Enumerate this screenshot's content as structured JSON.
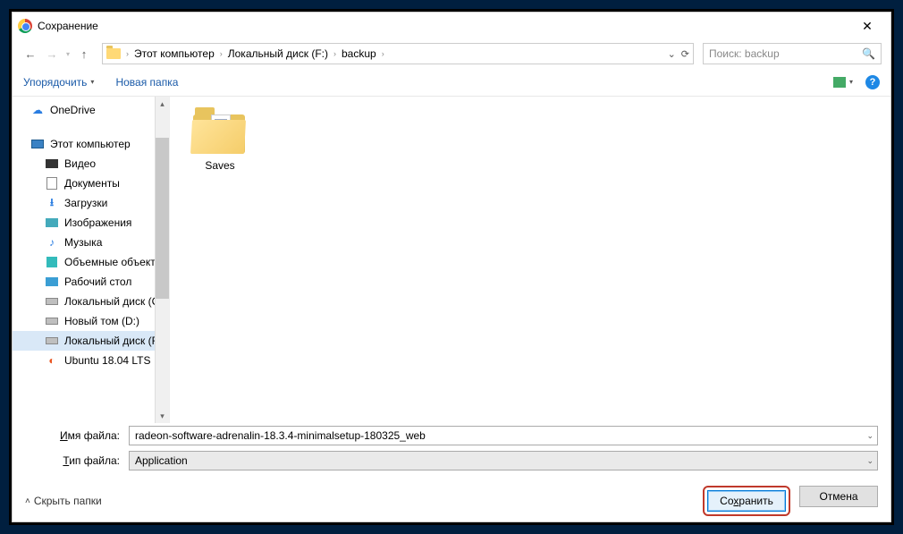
{
  "title": "Сохранение",
  "breadcrumb": [
    "Этот компьютер",
    "Локальный диск (F:)",
    "backup"
  ],
  "search_placeholder": "Поиск: backup",
  "toolbar": {
    "organize": "Упорядочить",
    "newfolder": "Новая папка"
  },
  "sidebar": {
    "items": [
      {
        "label": "OneDrive",
        "icon": "cloud",
        "indent": false
      },
      {
        "label": "Этот компьютер",
        "icon": "pc",
        "indent": false
      },
      {
        "label": "Видео",
        "icon": "vid",
        "indent": true
      },
      {
        "label": "Документы",
        "icon": "doc",
        "indent": true
      },
      {
        "label": "Загрузки",
        "icon": "dl",
        "indent": true
      },
      {
        "label": "Изображения",
        "icon": "img",
        "indent": true
      },
      {
        "label": "Музыка",
        "icon": "music",
        "indent": true
      },
      {
        "label": "Объемные объекты",
        "icon": "3d",
        "indent": true
      },
      {
        "label": "Рабочий стол",
        "icon": "desk",
        "indent": true
      },
      {
        "label": "Локальный диск (C:)",
        "icon": "drive",
        "indent": true
      },
      {
        "label": "Новый том (D:)",
        "icon": "drive",
        "indent": true
      },
      {
        "label": "Локальный диск (F:)",
        "icon": "drive",
        "indent": true,
        "selected": true
      },
      {
        "label": "Ubuntu 18.04 LTS",
        "icon": "ubu",
        "indent": true
      }
    ]
  },
  "content": {
    "folders": [
      {
        "name": "Saves"
      }
    ]
  },
  "form": {
    "filename_label_pre": "Имя файла:",
    "filename_under": "И",
    "filename_rest": "мя файла:",
    "filetype_under": "Т",
    "filetype_rest": "ип файла:",
    "filename_value": "radeon-software-adrenalin-18.3.4-minimalsetup-180325_web",
    "filetype_value": "Application"
  },
  "footer": {
    "hide_folders": "Скрыть папки",
    "save_pre": "Со",
    "save_under": "х",
    "save_post": "ранить",
    "cancel": "Отмена"
  }
}
